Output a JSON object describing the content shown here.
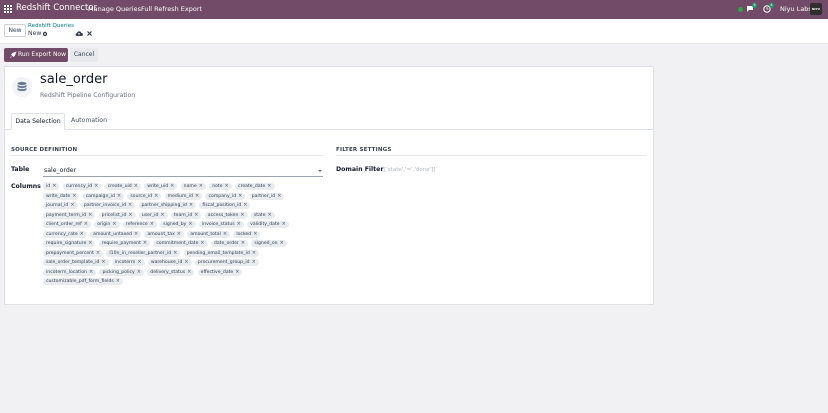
{
  "navbar": {
    "brand": "Redshift Connector",
    "menu": [
      "Manage Queries",
      "Full Refresh Export"
    ],
    "chat_badge": "5",
    "activity_badge": "4",
    "company": "Niyu Labs",
    "avatar_text": "NIYU LABS",
    "colors": {
      "bar": "#714b67",
      "status": "#28a745",
      "badge": "#1b9e6a"
    }
  },
  "control": {
    "new_label": "New",
    "breadcrumb_parent": "Redshift Queries",
    "breadcrumb_current": "New"
  },
  "actions": {
    "run_label": "Run Export Now",
    "cancel_label": "Cancel"
  },
  "record": {
    "title": "sale_order",
    "subtitle": "Redshift Pipeline Configuration",
    "icon": "database-icon"
  },
  "tabs": [
    {
      "label": "Data Selection",
      "active": true
    },
    {
      "label": "Automation",
      "active": false
    }
  ],
  "source": {
    "heading": "SOURCE DEFINITION",
    "table_label": "Table",
    "table_value": "sale_order",
    "columns_label": "Columns",
    "columns": [
      [
        "id",
        "currency_id",
        "create_uid",
        "write_uid",
        "name",
        "note",
        "create_date"
      ],
      [
        "write_date",
        "campaign_id",
        "source_id",
        "medium_id",
        "company_id",
        "partner_id"
      ],
      [
        "journal_id",
        "partner_invoice_id",
        "partner_shipping_id",
        "fiscal_position_id"
      ],
      [
        "payment_term_id",
        "pricelist_id",
        "user_id",
        "team_id",
        "access_token",
        "state"
      ],
      [
        "client_order_ref",
        "origin",
        "reference",
        "signed_by",
        "invoice_status",
        "validity_date"
      ],
      [
        "currency_rate",
        "amount_untaxed",
        "amount_tax",
        "amount_total",
        "locked"
      ],
      [
        "require_signature",
        "require_payment",
        "commitment_date",
        "date_order",
        "signed_on"
      ],
      [
        "prepayment_percent",
        "l10n_in_reseller_partner_id",
        "pending_email_template_id"
      ],
      [
        "sale_order_template_id",
        "incoterm",
        "warehouse_id",
        "procurement_group_id"
      ],
      [
        "incoterm_location",
        "picking_policy",
        "delivery_status",
        "effective_date"
      ],
      [
        "customizable_pdf_form_fields"
      ]
    ]
  },
  "filter": {
    "heading": "FILTER SETTINGS",
    "domain_label": "Domain Filter",
    "domain_placeholder": "[['state','=','done']]"
  }
}
